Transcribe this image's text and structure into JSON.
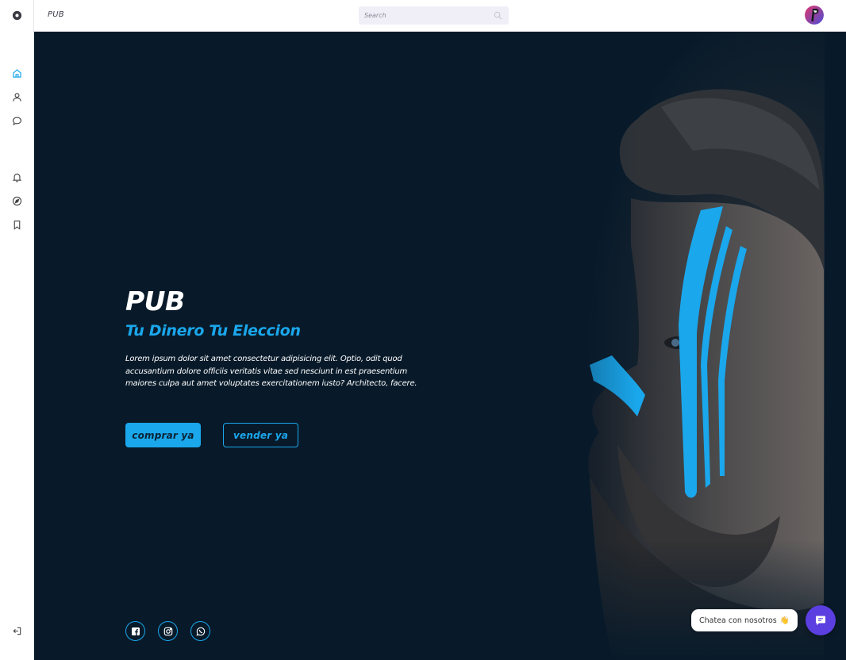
{
  "app": {
    "brand": "PUB"
  },
  "search": {
    "placeholder": "Search"
  },
  "sidebar": {
    "items": [
      {
        "icon": "logo-circle-icon",
        "label": "logo"
      },
      {
        "icon": "home-icon",
        "label": "home",
        "active": true
      },
      {
        "icon": "user-icon",
        "label": "profile"
      },
      {
        "icon": "chat-icon",
        "label": "messages"
      },
      {
        "icon": "bell-icon",
        "label": "notifications"
      },
      {
        "icon": "compass-icon",
        "label": "explore"
      },
      {
        "icon": "bookmark-icon",
        "label": "saved"
      },
      {
        "icon": "logout-icon",
        "label": "logout"
      }
    ]
  },
  "hero": {
    "title": "PUB",
    "subtitle": "Tu Dinero Tu Eleccion",
    "description": "Lorem ipsum dolor sit amet consectetur adipisicing elit. Optio, odit quod accusantium dolore officiis veritatis vitae sed nesciunt in est praesentium maiores culpa aut amet voluptates exercitationem iusto? Architecto, facere.",
    "buy_label": "comprar ya",
    "sell_label": "vender ya"
  },
  "social": [
    {
      "icon": "facebook-icon"
    },
    {
      "icon": "instagram-icon"
    },
    {
      "icon": "whatsapp-icon"
    }
  ],
  "chat": {
    "label": "Chatea con nosotros",
    "emoji": "👋"
  },
  "colors": {
    "accent": "#1aa7ec",
    "hero_bg": "#081a2a",
    "chat_button": "#5b3fe0",
    "sidebar_active": "#1aa7ec"
  }
}
